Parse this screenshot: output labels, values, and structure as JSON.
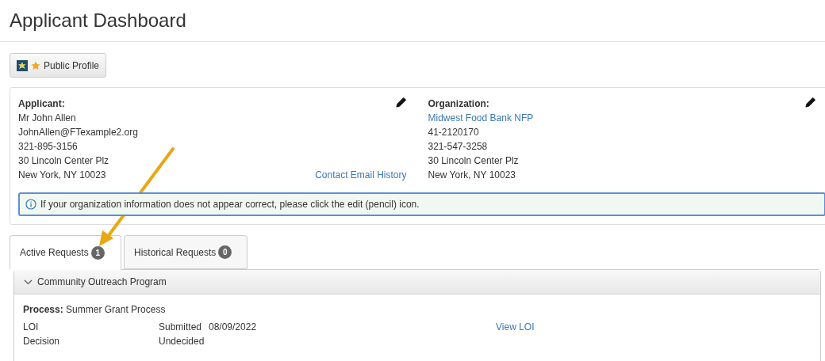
{
  "page": {
    "title": "Applicant Dashboard"
  },
  "profile_button": {
    "label": "Public Profile"
  },
  "applicant": {
    "heading": "Applicant:",
    "lines": [
      "Mr John Allen",
      "JohnAllen@FTexample2.org",
      "321-895-3156",
      "30 Lincoln Center Plz",
      "New York, NY 10023"
    ],
    "link": "Contact Email History"
  },
  "organization": {
    "heading": "Organization:",
    "name": "Midwest Food Bank NFP",
    "lines": [
      "41-2120170",
      "321-547-3258",
      "30 Lincoln Center Plz",
      "New York, NY 10023"
    ]
  },
  "info_alert": {
    "text": "If your organization information does not appear correct, please click the edit (pencil) icon."
  },
  "tabs": [
    {
      "label": "Active Requests",
      "count": "1",
      "selected": true
    },
    {
      "label": "Historical Requests",
      "count": "0",
      "selected": false
    }
  ],
  "request": {
    "program": "Community Outreach Program",
    "expanded": true,
    "process": "**Process:** Summer Grant Process",
    "rows": [
      {
        "step": "LOI",
        "status": "Submitted",
        "date": "08/09/2022",
        "link": "View LOI"
      },
      {
        "step": "Decision",
        "status": "Undecided"
      }
    ]
  }
}
